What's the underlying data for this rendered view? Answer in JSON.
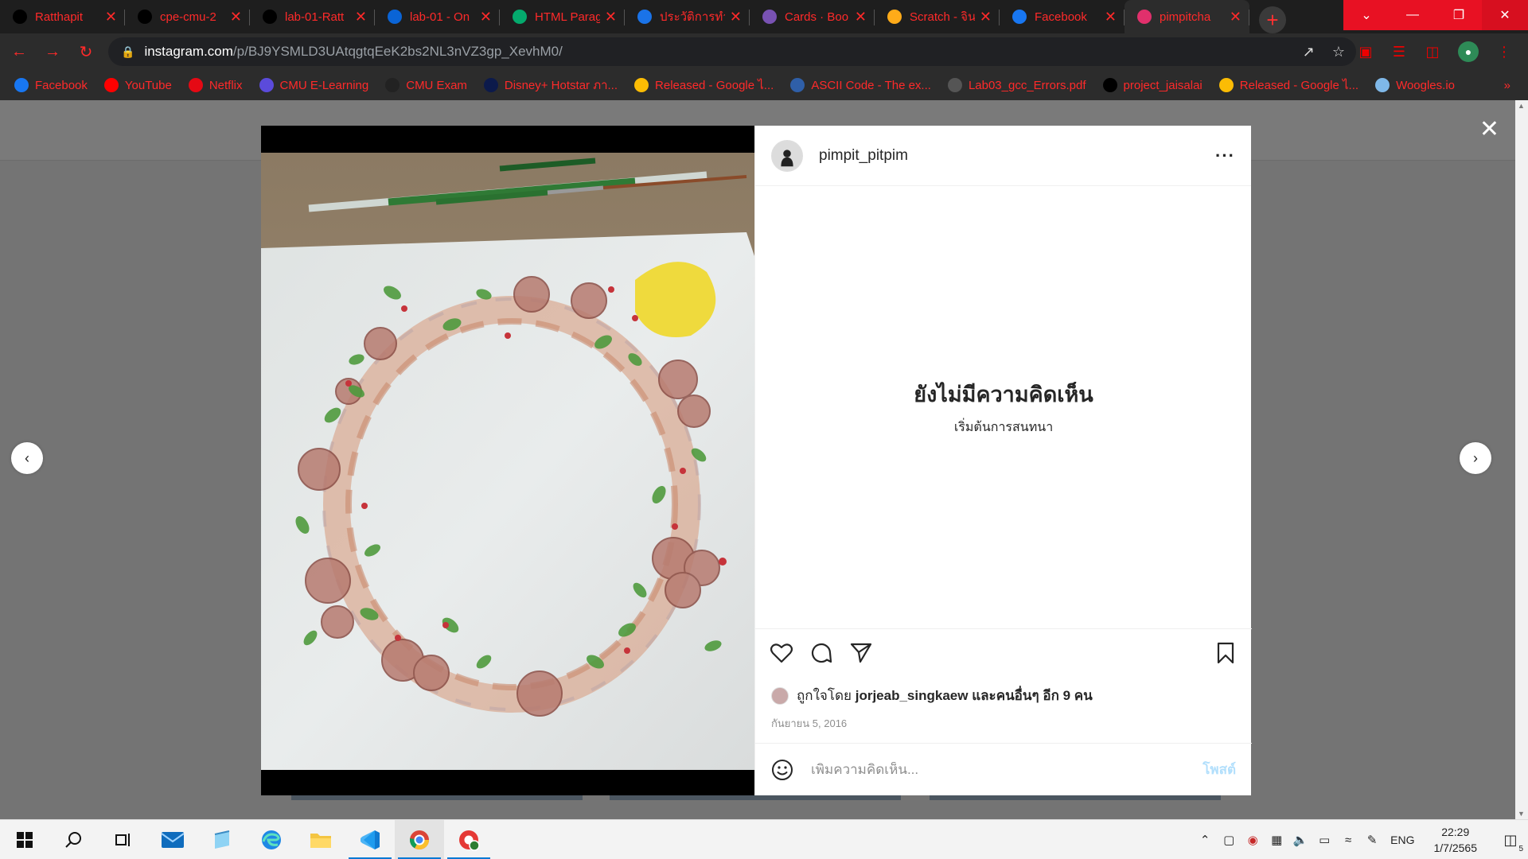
{
  "browser": {
    "tabs": [
      {
        "title": "Ratthapit",
        "favicon": "github-icon",
        "fav_color": "#000000"
      },
      {
        "title": "cpe-cmu-2",
        "favicon": "github-icon",
        "fav_color": "#000000"
      },
      {
        "title": "lab-01-Ratt",
        "favicon": "github-icon",
        "fav_color": "#000000"
      },
      {
        "title": "lab-01 - On",
        "favicon": "onedrive-icon",
        "fav_color": "#0a64d6"
      },
      {
        "title": "HTML Parag",
        "favicon": "w3schools-icon",
        "fav_color": "#04aa6d"
      },
      {
        "title": "ประวัติการทำ",
        "favicon": "history-icon",
        "fav_color": "#1a73e8"
      },
      {
        "title": "Cards · Boo",
        "favicon": "bootstrap-icon",
        "fav_color": "#7952b3"
      },
      {
        "title": "Scratch - จิน",
        "favicon": "scratch-icon",
        "fav_color": "#ffab19"
      },
      {
        "title": "Facebook",
        "favicon": "facebook-icon",
        "fav_color": "#1877f2"
      },
      {
        "title": "pimpitcha",
        "favicon": "instagram-icon",
        "fav_color": "#e1306c"
      }
    ],
    "new_tab_label": "+",
    "url_domain": "instagram.com",
    "url_path": "/p/BJ9YSMLD3UAtqgtqEeK2bs2NL3nVZ3gp_XevhM0/",
    "bookmarks": [
      {
        "label": "Facebook",
        "icon": "facebook-icon",
        "color": "#1877f2"
      },
      {
        "label": "YouTube",
        "icon": "youtube-icon",
        "color": "#ff0000"
      },
      {
        "label": "Netflix",
        "icon": "netflix-icon",
        "color": "#e50914"
      },
      {
        "label": "CMU E-Learning",
        "icon": "cmu-elearning-icon",
        "color": "#5b4bdb"
      },
      {
        "label": "CMU Exam",
        "icon": "cmu-exam-icon",
        "color": "#222222"
      },
      {
        "label": "Disney+ Hotstar ภา...",
        "icon": "hotstar-icon",
        "color": "#0c1a4b"
      },
      {
        "label": "Released - Google ไ...",
        "icon": "google-drive-icon",
        "color": "#fbbc04"
      },
      {
        "label": "ASCII Code - The ex...",
        "icon": "ascii-icon",
        "color": "#2f5fa8"
      },
      {
        "label": "Lab03_gcc_Errors.pdf",
        "icon": "globe-icon",
        "color": "#555555"
      },
      {
        "label": "project_jaisalai",
        "icon": "github-icon",
        "color": "#000000"
      },
      {
        "label": "Released - Google ไ...",
        "icon": "google-drive-icon",
        "color": "#fbbc04"
      },
      {
        "label": "Woogles.io",
        "icon": "woogles-icon",
        "color": "#7fb8e8"
      }
    ],
    "bookmarks_more": "»"
  },
  "post": {
    "username": "pimpit_pitpim",
    "no_comments_title": "ยังไม่มีความคิดเห็น",
    "no_comments_sub": "เริ่มต้นการสนทนา",
    "likes_prefix": "ถูกใจโดย",
    "likes_user": "jorjeab_singkaew",
    "likes_suffix": "และคนอื่นๆ อีก 9 คน",
    "date": "กันยายน 5, 2016",
    "comment_placeholder": "เพิ่มความคิดเห็น...",
    "post_button": "โพสต์"
  },
  "taskbar": {
    "language": "ENG",
    "time": "22:29",
    "date": "1/7/2565",
    "notification_count": "5"
  }
}
